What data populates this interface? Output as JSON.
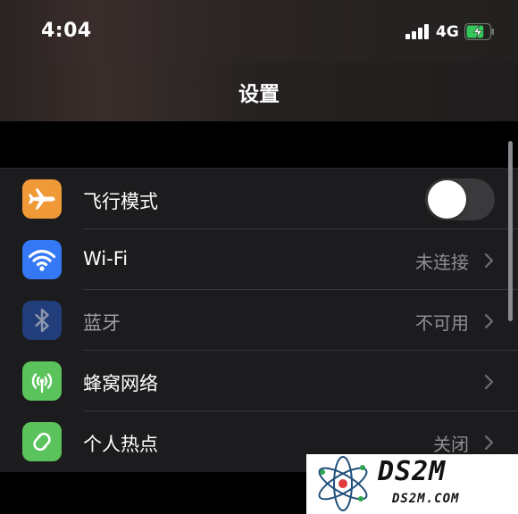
{
  "status_bar": {
    "time": "4:04",
    "network": "4G",
    "signal_bars": 4,
    "battery_charge": 0.75,
    "battery_color": "#34c759",
    "charging": true
  },
  "nav": {
    "title": "设置"
  },
  "settings": [
    {
      "label": "飞行模式",
      "icon": "airplane-icon",
      "icon_color": "#f09a37",
      "control": "toggle",
      "toggle_on": false,
      "value": ""
    },
    {
      "label": "Wi-Fi",
      "icon": "wifi-icon",
      "icon_color": "#3478f6",
      "control": "chevron",
      "value": "未连接"
    },
    {
      "label": "蓝牙",
      "icon": "bluetooth-icon",
      "icon_color": "#213d7a",
      "control": "chevron",
      "value": "不可用",
      "disabled": true
    },
    {
      "label": "蜂窝网络",
      "icon": "cellular-antenna-icon",
      "icon_color": "#5bc35b",
      "control": "chevron",
      "value": ""
    },
    {
      "label": "个人热点",
      "icon": "personal-hotspot-icon",
      "icon_color": "#5bc35b",
      "control": "chevron",
      "value": "关闭"
    }
  ],
  "watermark": {
    "title": "DS2M",
    "subtitle": "DS2M.COM"
  }
}
